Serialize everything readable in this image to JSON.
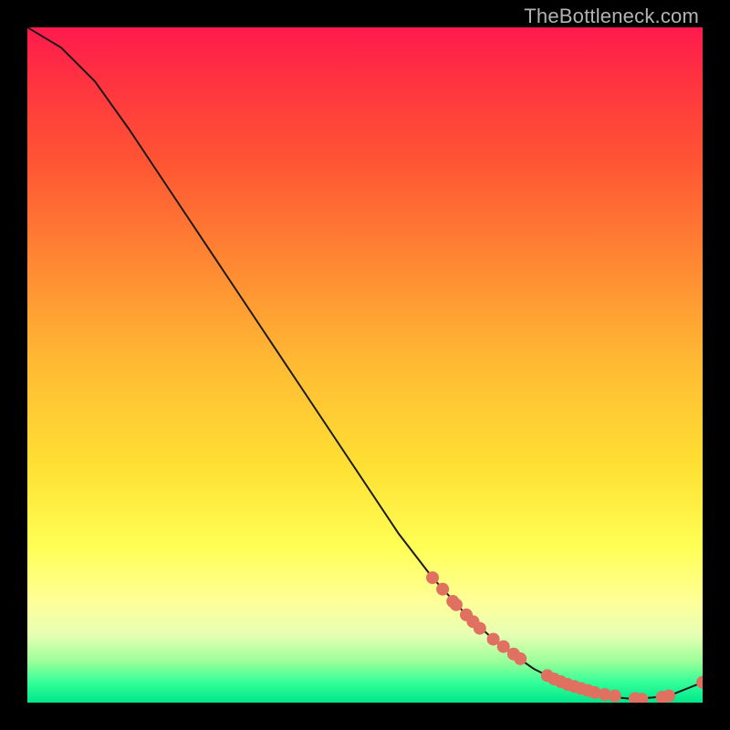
{
  "attribution": "TheBottleneck.com",
  "colors": {
    "curve_stroke": "#1a1a1a",
    "marker_fill": "#e07060",
    "marker_stroke": "#b84838"
  },
  "chart_data": {
    "type": "line",
    "title": "",
    "xlabel": "",
    "ylabel": "",
    "xlim": [
      0,
      100
    ],
    "ylim": [
      0,
      100
    ],
    "series": [
      {
        "name": "curve",
        "x": [
          0,
          5,
          10,
          15,
          20,
          25,
          30,
          35,
          40,
          45,
          50,
          55,
          60,
          65,
          70,
          75,
          80,
          85,
          90,
          95,
          100
        ],
        "y": [
          100,
          97,
          92,
          85,
          77.5,
          70,
          62.5,
          55,
          47.5,
          40,
          32.5,
          25,
          18.5,
          13,
          8.5,
          5,
          2.5,
          1,
          0.5,
          1,
          3
        ]
      }
    ],
    "markers": {
      "name": "highlight",
      "x": [
        60,
        61.5,
        63,
        63.5,
        65,
        66,
        67,
        69,
        70.5,
        72,
        73,
        77,
        78,
        79,
        80,
        81,
        82,
        83,
        84,
        85.5,
        87,
        90,
        91,
        94,
        95,
        100
      ],
      "y": [
        18.5,
        16.8,
        15,
        14.5,
        13,
        12,
        11,
        9.4,
        8.3,
        7.2,
        6.5,
        4,
        3.5,
        3.1,
        2.7,
        2.4,
        2.1,
        1.8,
        1.5,
        1.2,
        1,
        0.6,
        0.5,
        0.8,
        1,
        3
      ]
    }
  }
}
